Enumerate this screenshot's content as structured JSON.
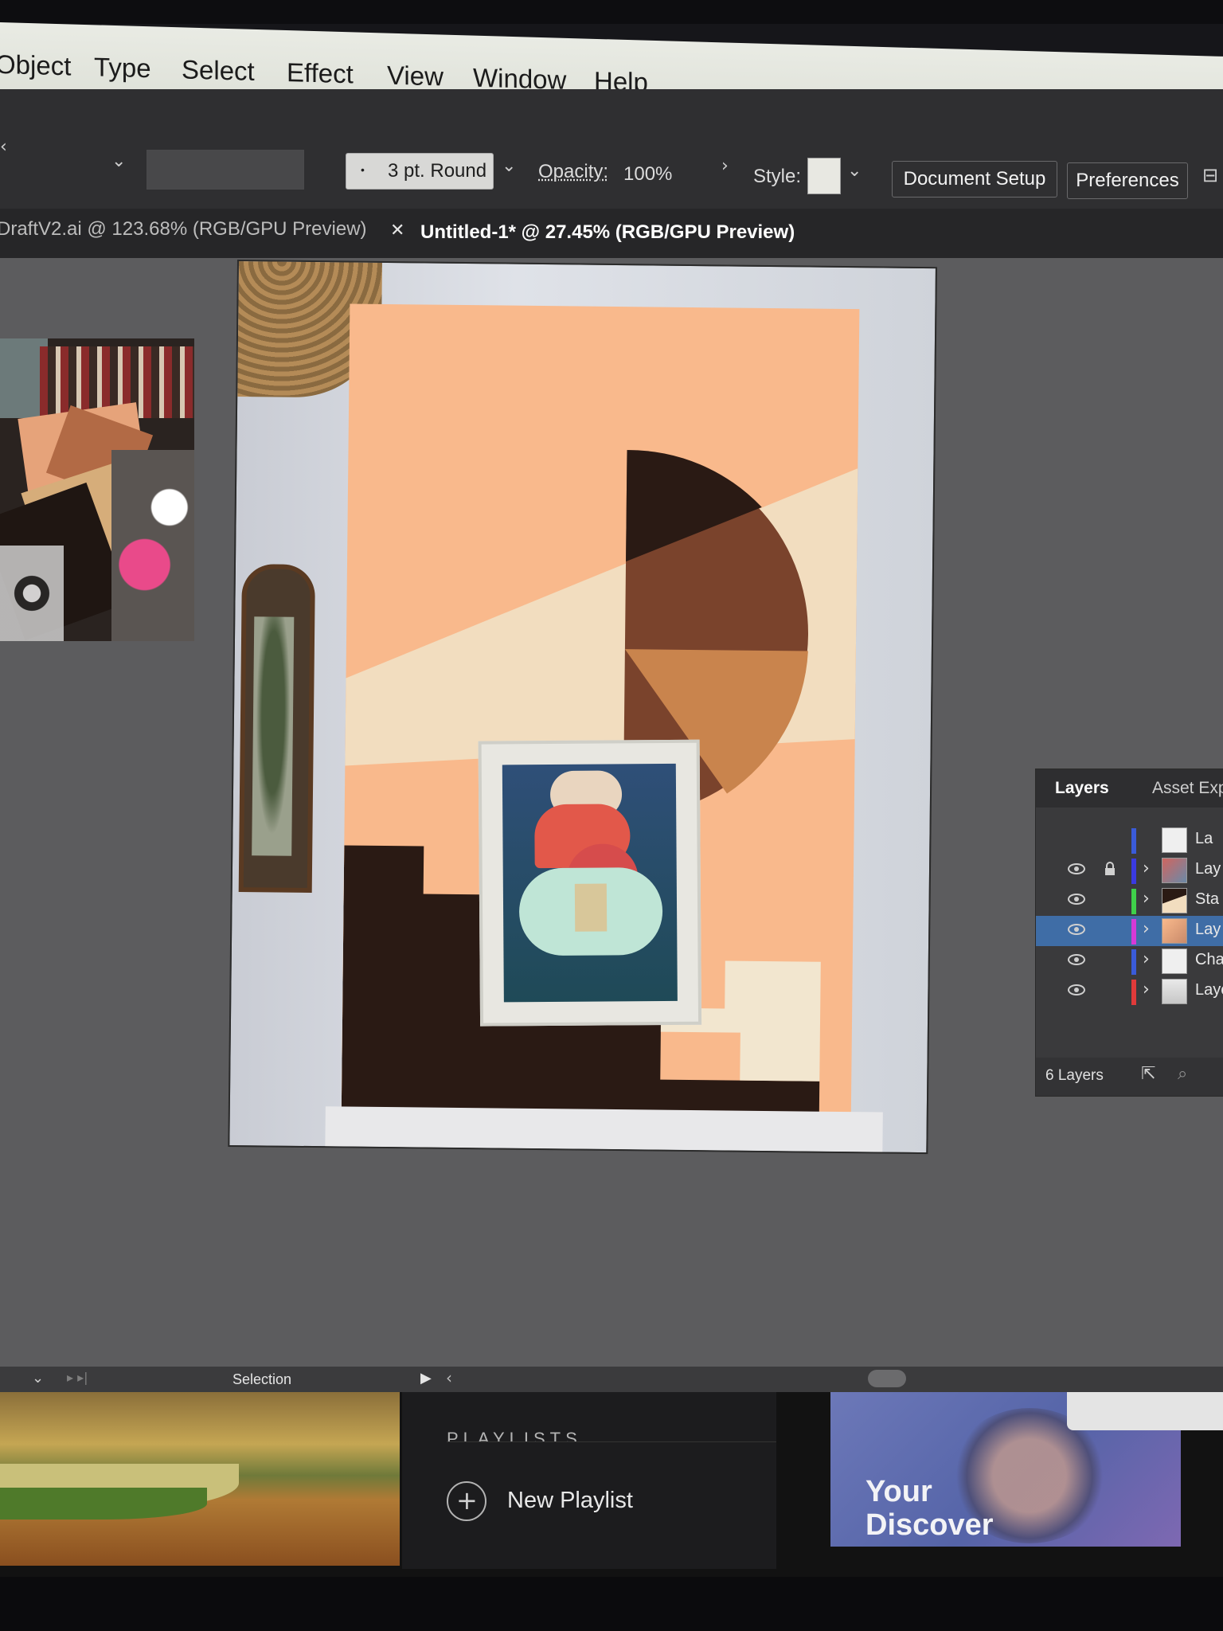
{
  "menu": {
    "items": [
      "Object",
      "Type",
      "Select",
      "Effect",
      "View",
      "Window",
      "Help"
    ]
  },
  "control_bar": {
    "stroke_profile": "3 pt. Round",
    "opacity_label": "Opacity:",
    "opacity_value": "100%",
    "style_label": "Style:",
    "document_setup": "Document Setup",
    "preferences": "Preferences"
  },
  "tabs": [
    {
      "label": "DraftV2.ai @ 123.68% (RGB/GPU Preview)",
      "active": false
    },
    {
      "label": "Untitled-1* @ 27.45% (RGB/GPU Preview)",
      "active": true
    }
  ],
  "layers_panel": {
    "tabs": [
      "Layers",
      "Asset Exp"
    ],
    "rows": [
      {
        "name": "La",
        "color": "#3a5bd9",
        "visible": false,
        "locked": false,
        "expandable": false,
        "selected": false
      },
      {
        "name": "Lay",
        "color": "#3a3ae0",
        "visible": true,
        "locked": true,
        "expandable": true,
        "selected": false
      },
      {
        "name": "Sta",
        "color": "#3fd04a",
        "visible": true,
        "locked": false,
        "expandable": true,
        "selected": false
      },
      {
        "name": "Lay",
        "color": "#d63ad6",
        "visible": true,
        "locked": false,
        "expandable": true,
        "selected": true
      },
      {
        "name": "Cha",
        "color": "#3a5bd9",
        "visible": true,
        "locked": false,
        "expandable": true,
        "selected": false
      },
      {
        "name": "Laye",
        "color": "#e03a3a",
        "visible": true,
        "locked": false,
        "expandable": true,
        "selected": false
      }
    ],
    "footer_count": "6 Layers"
  },
  "status_bar": {
    "tool": "Selection"
  },
  "spotify": {
    "playlists_heading": "PLAYLISTS",
    "new_playlist": "New Playlist",
    "discover_line1": "Your",
    "discover_line2": "Discover"
  },
  "colors": {
    "peach": "#f9b98c",
    "brown": "#7a432c",
    "dark": "#2a1a14",
    "cream": "#f2ddbf",
    "selection_highlight": "#3f6da6"
  }
}
